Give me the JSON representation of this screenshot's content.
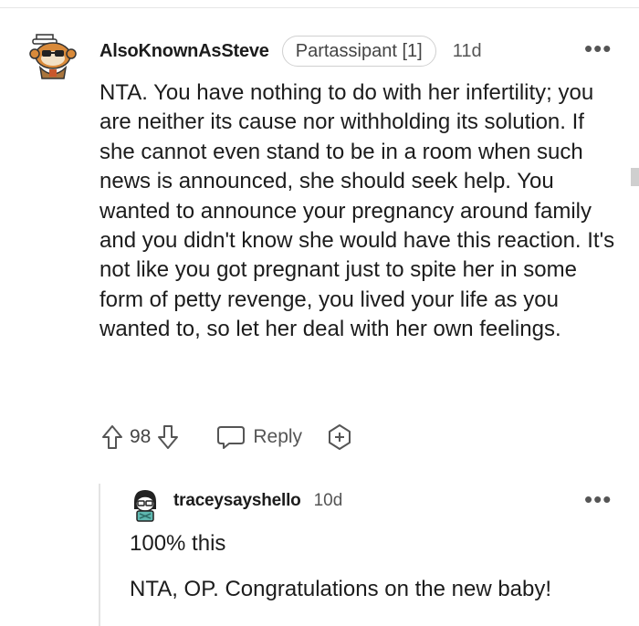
{
  "comment": {
    "username": "AlsoKnownAsSteve",
    "flair": "Partassipant [1]",
    "time": "11d",
    "body": "NTA. You have nothing to do with her infertility; you are neither its cause nor withholding its solution. If she cannot even stand to be in a room when such news is announced, she should seek help. You wanted to announce your pregnancy around family and you didn't know she would have this reaction. It's not like you got pregnant just to spite her in some form of petty revenge, you lived your life as you wanted to, so let her deal with her own feelings.",
    "votes": "98",
    "reply_label": "Reply",
    "more_label": "•••"
  },
  "reply": {
    "username": "traceysayshello",
    "time": "10d",
    "para1": "100% this",
    "para2": "NTA, OP. Congratulations on the new baby!",
    "more_label": "•••"
  },
  "icons": {
    "upvote": "arrow-up-icon",
    "downvote": "arrow-down-icon",
    "reply": "speech-bubble-icon",
    "award": "award-plus-icon",
    "more": "more-options-icon"
  },
  "colors": {
    "text": "#1c1c1c",
    "muted": "#555555",
    "border": "#d0d0d0"
  }
}
